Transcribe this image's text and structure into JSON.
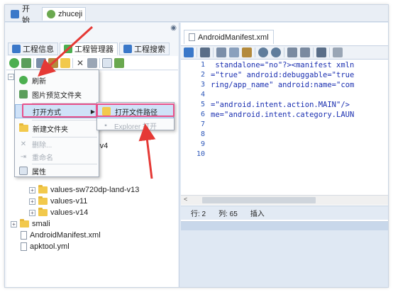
{
  "top_tabs": [
    {
      "label": "开始",
      "icon": "home-icon"
    },
    {
      "label": "zhuceji",
      "icon": "gear-icon"
    }
  ],
  "left_tabs": [
    {
      "label": "工程信息",
      "icon": "info-icon"
    },
    {
      "label": "工程管理器",
      "icon": "project-manager-icon"
    },
    {
      "label": "工程搜索",
      "icon": "search-icon"
    }
  ],
  "context_menu": {
    "refresh": "刷新",
    "image_preview": "图片预览文件夹",
    "open_with": "打开方式",
    "new_folder": "新建文件夹",
    "delete": "删除...",
    "rename": "重命名",
    "properties": "属性"
  },
  "submenu": {
    "open_path": "打开文件路径",
    "explorer_open": "Explorer 打开"
  },
  "tree": {
    "partial_item": "-v4",
    "items": [
      {
        "label": "values-sw720dp-land-v13",
        "type": "folder"
      },
      {
        "label": "values-v11",
        "type": "folder"
      },
      {
        "label": "values-v14",
        "type": "folder"
      },
      {
        "label": "smali",
        "type": "folder"
      },
      {
        "label": "AndroidManifest.xml",
        "type": "file"
      },
      {
        "label": "apktool.yml",
        "type": "file"
      }
    ]
  },
  "editor": {
    "tab_title": "AndroidManifest.xml",
    "line_numbers": [
      "1",
      "2",
      "3",
      "4",
      "5",
      "6",
      "7",
      "8",
      "9",
      "10"
    ],
    "lines": [
      " standalone=\"no\"?><manifest xmln",
      "=\"true\" android:debuggable=\"true",
      "ring/app_name\" android:name=\"com",
      "",
      "=\"android.intent.action.MAIN\"/>",
      "me=\"android.intent.category.LAUN"
    ]
  },
  "status": {
    "row": "行: 2",
    "col": "列: 65",
    "mode": "插入"
  },
  "colors": {
    "accent": "#e8508a",
    "code_text": "#1a2fb0",
    "line_number": "#2b55b8"
  }
}
